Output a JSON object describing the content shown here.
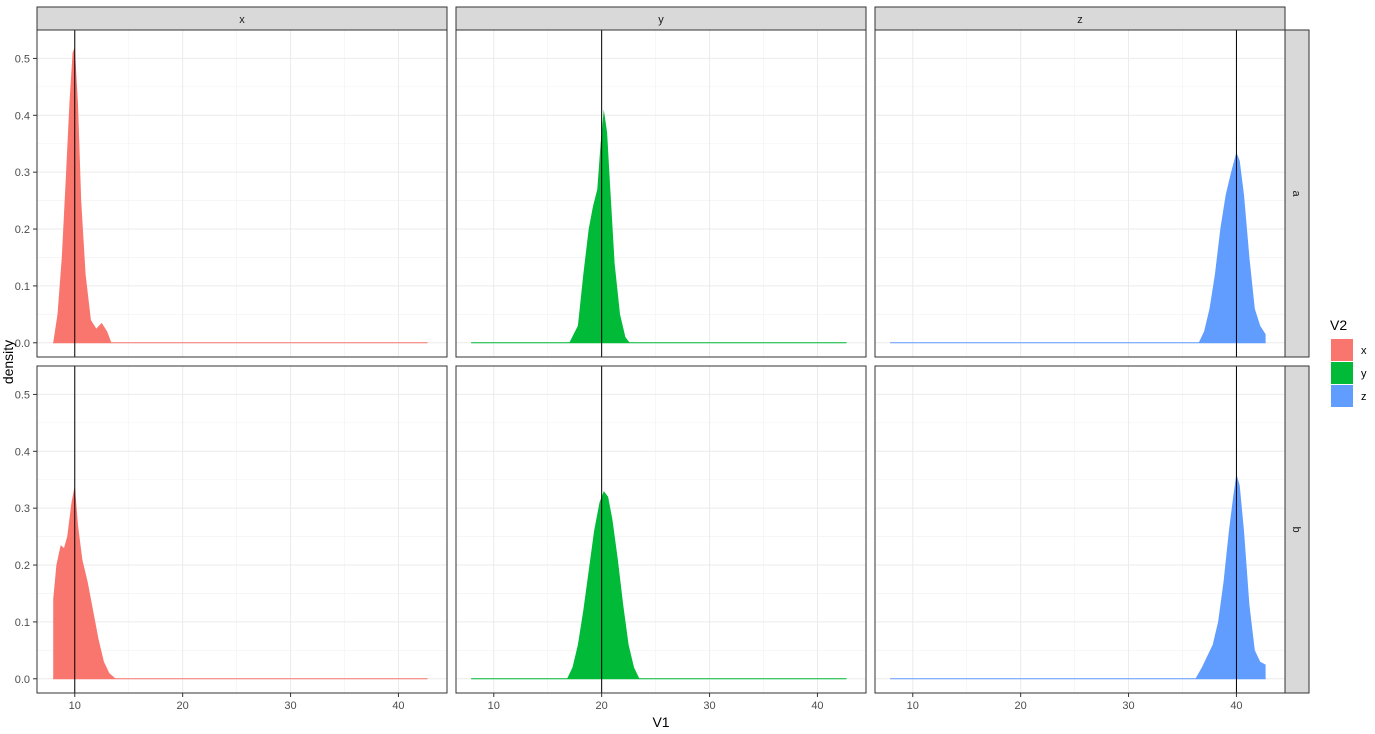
{
  "chart_data": {
    "type": "area",
    "subtype": "faceted density plot",
    "facet_columns": [
      "x",
      "y",
      "z"
    ],
    "facet_rows": [
      "a",
      "b"
    ],
    "xlabel": "V1",
    "ylabel": "density",
    "xlim": [
      6.5,
      44.5
    ],
    "ylim": [
      -0.025,
      0.55
    ],
    "x_ticks": [
      10,
      20,
      30,
      40
    ],
    "y_ticks": [
      0.0,
      0.1,
      0.2,
      0.3,
      0.4,
      0.5
    ],
    "y_tick_labels": [
      "0.0",
      "0.1",
      "0.2",
      "0.3",
      "0.4",
      "0.5"
    ],
    "grid": true,
    "legend": {
      "title": "V2",
      "position": "right",
      "entries": [
        {
          "label": "x",
          "color": "#F8766D"
        },
        {
          "label": "y",
          "color": "#00BA38"
        },
        {
          "label": "z",
          "color": "#619CFF"
        }
      ]
    },
    "panels": [
      {
        "col": "x",
        "row": "a",
        "color": "#F8766D",
        "vline": 10,
        "x": [
          8.0,
          8.4,
          8.8,
          9.2,
          9.5,
          9.8,
          10.0,
          10.3,
          10.6,
          11.0,
          11.5,
          12.0,
          12.5,
          13.0,
          13.4,
          14,
          20,
          30,
          42.7
        ],
        "y": [
          0.0,
          0.05,
          0.15,
          0.3,
          0.42,
          0.51,
          0.52,
          0.42,
          0.25,
          0.12,
          0.04,
          0.025,
          0.035,
          0.02,
          0.0,
          0,
          0,
          0,
          0
        ]
      },
      {
        "col": "y",
        "row": "a",
        "color": "#00BA38",
        "vline": 20,
        "x": [
          7.9,
          17.0,
          17.8,
          18.3,
          18.8,
          19.2,
          19.6,
          19.9,
          20.2,
          20.5,
          20.8,
          21.2,
          21.7,
          22.2,
          22.6,
          30,
          42.7
        ],
        "y": [
          0,
          0,
          0.03,
          0.12,
          0.2,
          0.24,
          0.27,
          0.35,
          0.41,
          0.37,
          0.27,
          0.14,
          0.05,
          0.01,
          0,
          0,
          0
        ],
        "baseline_from": 7.9
      },
      {
        "col": "z",
        "row": "a",
        "color": "#619CFF",
        "vline": 40,
        "x": [
          7.9,
          36.5,
          37.0,
          37.5,
          38.0,
          38.5,
          39.0,
          39.5,
          40.0,
          40.3,
          40.7,
          41.2,
          41.7,
          42.2,
          42.7
        ],
        "y": [
          0,
          0,
          0.02,
          0.06,
          0.12,
          0.2,
          0.26,
          0.3,
          0.335,
          0.32,
          0.26,
          0.15,
          0.06,
          0.03,
          0.015
        ],
        "baseline_from": 7.9
      },
      {
        "col": "x",
        "row": "b",
        "color": "#F8766D",
        "vline": 10,
        "x": [
          8.0,
          8.0,
          8.3,
          8.7,
          9.0,
          9.3,
          9.7,
          10.0,
          10.3,
          10.7,
          11.2,
          11.7,
          12.2,
          12.7,
          13.2,
          13.8,
          20,
          30,
          42.7
        ],
        "y": [
          0.0,
          0.14,
          0.2,
          0.235,
          0.23,
          0.25,
          0.31,
          0.34,
          0.27,
          0.21,
          0.17,
          0.12,
          0.07,
          0.03,
          0.01,
          0.0,
          0,
          0,
          0
        ]
      },
      {
        "col": "y",
        "row": "b",
        "color": "#00BA38",
        "vline": 20,
        "x": [
          7.9,
          16.8,
          17.3,
          17.8,
          18.3,
          18.8,
          19.3,
          19.8,
          20.2,
          20.6,
          21.0,
          21.5,
          22.0,
          22.5,
          23.0,
          23.5,
          30,
          42.7
        ],
        "y": [
          0,
          0,
          0.02,
          0.06,
          0.12,
          0.19,
          0.26,
          0.31,
          0.33,
          0.32,
          0.28,
          0.21,
          0.13,
          0.06,
          0.02,
          0,
          0,
          0
        ],
        "baseline_from": 7.9
      },
      {
        "col": "z",
        "row": "b",
        "color": "#619CFF",
        "vline": 40,
        "x": [
          7.9,
          36.2,
          36.8,
          37.3,
          37.8,
          38.3,
          38.8,
          39.3,
          39.7,
          40.0,
          40.3,
          40.7,
          41.2,
          41.7,
          42.2,
          42.7
        ],
        "y": [
          0,
          0,
          0.02,
          0.04,
          0.06,
          0.1,
          0.17,
          0.26,
          0.32,
          0.36,
          0.34,
          0.26,
          0.13,
          0.05,
          0.03,
          0.025
        ],
        "baseline_from": 7.9
      }
    ]
  }
}
